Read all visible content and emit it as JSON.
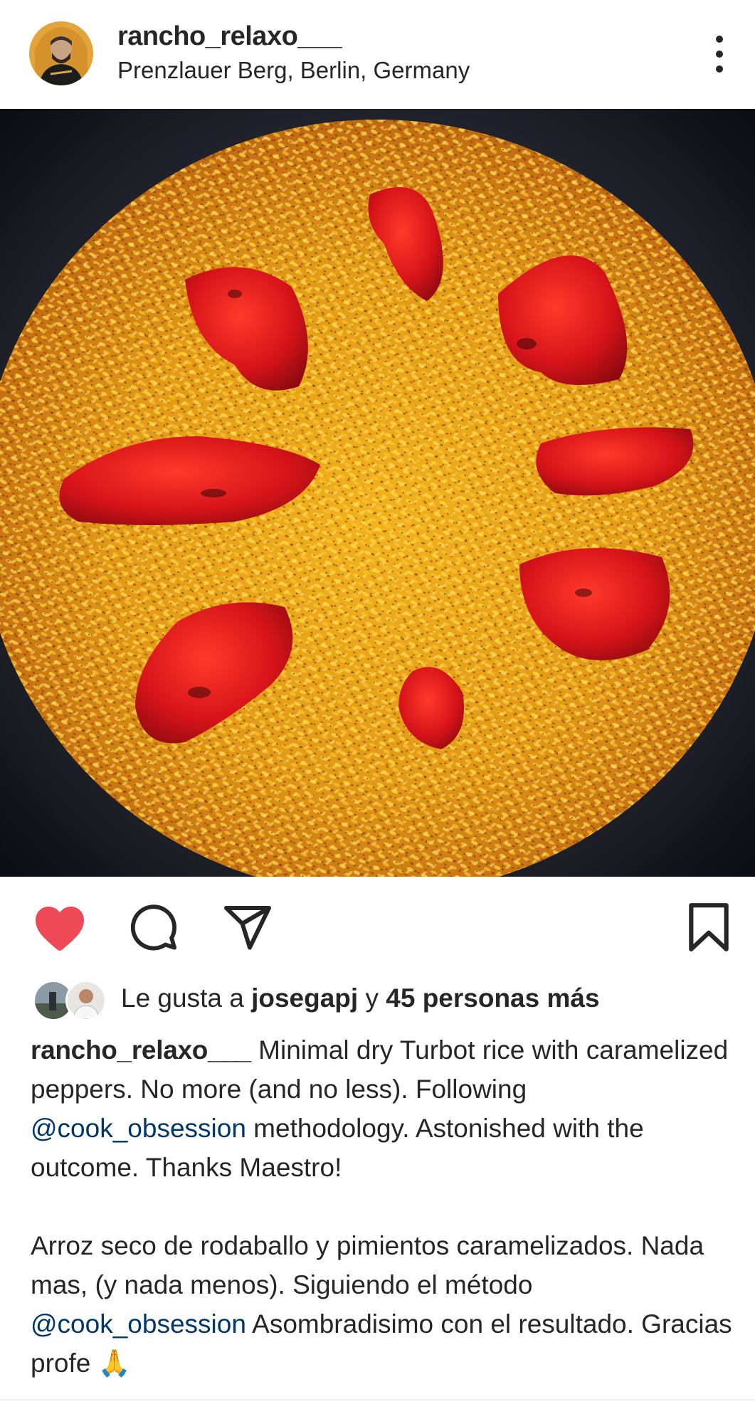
{
  "post": {
    "username": "rancho_relaxo___",
    "location": "Prenzlauer Berg, Berlin, Germany",
    "more_icon": "more-vertical-icon",
    "photo_icon": "paella-photo"
  },
  "actions": {
    "like_icon": "heart-filled-icon",
    "like_color": "#ed4956",
    "comment_icon": "comment-icon",
    "share_icon": "send-icon",
    "save_icon": "bookmark-icon"
  },
  "likes": {
    "prefix": "Le gusta a ",
    "user": "josegapj",
    "middle": " y ",
    "others": "45 personas más"
  },
  "caption": {
    "username": "rancho_relaxo___",
    "line1_text": " Minimal dry Turbot rice with caramelized peppers. No more (and no less). Following ",
    "mention1": "@cook_obsession",
    "line1_end": " methodology. Astonished with the outcome.  Thanks Maestro!",
    "es_text": "Arroz seco de rodaballo y pimientos caramelizados. Nada mas, (y nada menos). Siguiendo el método ",
    "mention2": "@cook_obsession",
    "es_end": " Asombradisimo con el resultado. Gracias profe 🙏"
  },
  "colors": {
    "text": "#262626",
    "mention": "#00376b",
    "like": "#ed4956"
  }
}
